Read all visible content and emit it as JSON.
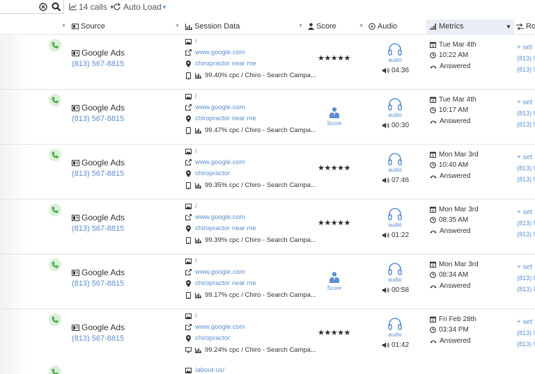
{
  "toolbar": {
    "calls_label": "14 calls",
    "autoload_label": "Auto Load"
  },
  "columns": {
    "source": "Source",
    "session": "Session Data",
    "score": "Score",
    "audio": "Audio",
    "metrics": "Metrics",
    "route": "Rou"
  },
  "calls": [
    {
      "source": "Google Ads",
      "phone": "(813) 567-8815",
      "path": "/",
      "referrer": "www.google.com",
      "keyword": "chiropractor near me",
      "device": "mobile-icon",
      "campaign": "99.40% cpc / Chiro - Search Campa...",
      "score_type": "stars",
      "score_stars": "★★★★★",
      "score_label": "",
      "audio_label": "audio",
      "duration": "04:36",
      "date": "Tue Mar 4th",
      "time": "10:22 AM",
      "status": "Answered",
      "route_set": "set",
      "route_phone1": "(813) 9",
      "route_phone2": "(813) 9"
    },
    {
      "source": "Google Ads",
      "phone": "(813) 567-8815",
      "path": "/",
      "referrer": "www.google.com",
      "keyword": "chiropractor near me",
      "device": "mobile-icon",
      "campaign": "99.47% cpc / Chiro - Search Campa...",
      "score_type": "button",
      "score_stars": "",
      "score_label": "Score",
      "audio_label": "audio",
      "duration": "00:30",
      "date": "Tue Mar 4th",
      "time": "10:17 AM",
      "status": "Answered",
      "route_set": "set",
      "route_phone1": "(813) 9",
      "route_phone2": "(813) 9"
    },
    {
      "source": "Google Ads",
      "phone": "(813) 567-8815",
      "path": "/",
      "referrer": "www.google.com",
      "keyword": "chiropractor",
      "device": "mobile-icon",
      "campaign": "99.35% cpc / Chiro - Search Campa...",
      "score_type": "stars",
      "score_stars": "★★★★★",
      "score_label": "",
      "audio_label": "audio",
      "duration": "07:46",
      "date": "Mon Mar 3rd",
      "time": "10:40 AM",
      "status": "Answered",
      "route_set": "set",
      "route_phone1": "(813) 9",
      "route_phone2": "(813) 9"
    },
    {
      "source": "Google Ads",
      "phone": "(813) 567-8815",
      "path": "/",
      "referrer": "www.google.com",
      "keyword": "chiropractor near me",
      "device": "mobile-icon",
      "campaign": "99.39% cpc / Chiro - Search Campa...",
      "score_type": "stars",
      "score_stars": "★★★★★",
      "score_label": "",
      "audio_label": "audio",
      "duration": "01:22",
      "date": "Mon Mar 3rd",
      "time": "08:35 AM",
      "status": "Answered",
      "route_set": "set",
      "route_phone1": "(813) 9",
      "route_phone2": "(813) 9"
    },
    {
      "source": "Google Ads",
      "phone": "(813) 567-8815",
      "path": "/",
      "referrer": "www.google.com",
      "keyword": "chiropractor near me",
      "device": "mobile-icon",
      "campaign": "99.17% cpc / Chiro - Search Campa...",
      "score_type": "button",
      "score_stars": "",
      "score_label": "Score",
      "audio_label": "audio",
      "duration": "00:58",
      "date": "Mon Mar 3rd",
      "time": "08:34 AM",
      "status": "Answered",
      "route_set": "set",
      "route_phone1": "(813) 9",
      "route_phone2": "(813) 9"
    },
    {
      "source": "Google Ads",
      "phone": "(813) 567-8815",
      "path": "/",
      "referrer": "www.google.com",
      "keyword": "chiropractor",
      "device": "desktop-icon",
      "campaign": "99.24% cpc / Chiro - Search Campa...",
      "score_type": "stars",
      "score_stars": "★★★★★",
      "score_label": "",
      "audio_label": "audio",
      "duration": "01:42",
      "date": "Fri Feb 28th",
      "time": "03:34 PM",
      "status": "Answered",
      "route_set": "set",
      "route_phone1": "(813) 9",
      "route_phone2": "(813) 9"
    }
  ],
  "partial_row": {
    "path": "/about-us/"
  },
  "colors": {
    "link": "#5b8fcf",
    "phone_badge_bg": "#dcefd9",
    "phone_badge_fg": "#4caf50",
    "metrics_header_bg": "#e9eef5"
  }
}
